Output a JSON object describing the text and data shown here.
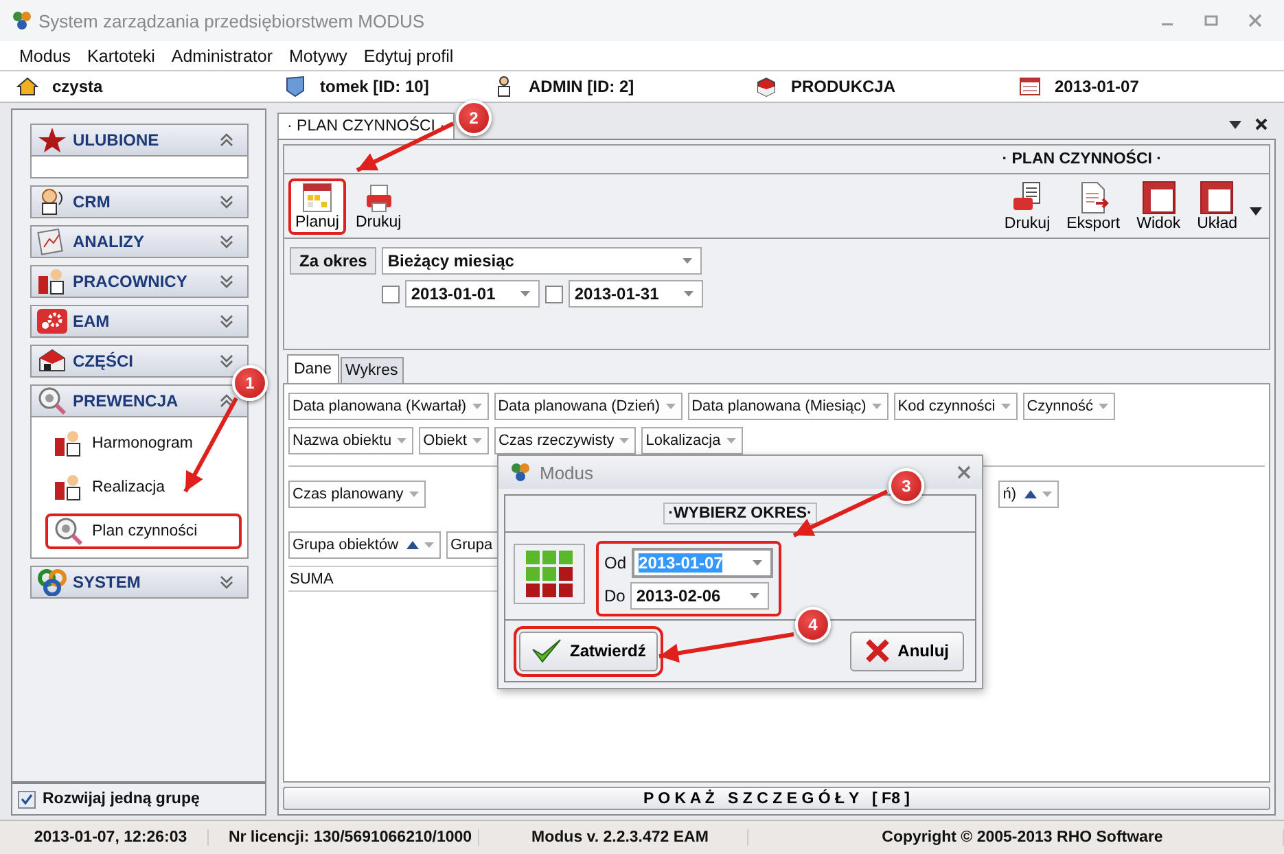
{
  "window": {
    "title": "System zarządzania przedsiębiorstwem MODUS"
  },
  "menu": [
    "Modus",
    "Kartoteki",
    "Administrator",
    "Motywy",
    "Edytuj profil"
  ],
  "info_bar": [
    {
      "kind": "home",
      "text": "czysta"
    },
    {
      "kind": "user",
      "text": "tomek [ID: 10]"
    },
    {
      "kind": "person",
      "text": "ADMIN [ID: 2]"
    },
    {
      "kind": "box",
      "text": "PRODUKCJA"
    },
    {
      "kind": "calendar",
      "text": "2013-01-07"
    }
  ],
  "sidebar": {
    "groups": [
      {
        "kind": "star",
        "label": "ULUBIONE",
        "expanded": true
      },
      {
        "kind": "person",
        "label": "CRM",
        "expanded": false
      },
      {
        "kind": "chart",
        "label": "ANALIZY",
        "expanded": false
      },
      {
        "kind": "tools",
        "label": "PRACOWNICY",
        "expanded": false
      },
      {
        "kind": "gear",
        "label": "EAM",
        "expanded": false
      },
      {
        "kind": "box",
        "label": "CZĘŚCI",
        "expanded": false
      },
      {
        "kind": "magnifier",
        "label": "PREWENCJA",
        "expanded": true,
        "children": [
          {
            "kind": "tools",
            "label": "Harmonogram",
            "highlighted": false
          },
          {
            "kind": "tools",
            "label": "Realizacja",
            "highlighted": false
          },
          {
            "kind": "magnifier",
            "label": "Plan czynności",
            "highlighted": true
          }
        ]
      },
      {
        "kind": "rings",
        "label": "SYSTEM",
        "expanded": false
      }
    ],
    "expand_one_group": {
      "label": "Rozwijaj jedną grupę",
      "checked": true
    }
  },
  "document_tab": {
    "label": "· PLAN CZYNNOŚCI ·"
  },
  "panel_title": "· PLAN CZYNNOŚCI ·",
  "toolbar_left": [
    {
      "kind": "plan",
      "label": "Planuj",
      "highlighted": true
    },
    {
      "kind": "printer",
      "label": "Drukuj",
      "highlighted": false
    }
  ],
  "toolbar_right": [
    {
      "kind": "print-doc",
      "label": "Drukuj"
    },
    {
      "kind": "export",
      "label": "Eksport"
    },
    {
      "kind": "grid",
      "label": "Widok"
    },
    {
      "kind": "grid",
      "label": "Układ"
    }
  ],
  "period": {
    "label": "Za okres",
    "preset": "Bieżący miesiąc",
    "from": {
      "checked": false,
      "value": "2013-01-01"
    },
    "to": {
      "checked": false,
      "value": "2013-01-31"
    }
  },
  "view_tabs": [
    {
      "label": "Dane",
      "selected": true
    },
    {
      "label": "Wykres",
      "selected": false
    }
  ],
  "filter_fields": [
    [
      {
        "label": "Data planowana (Kwartał)",
        "sorted": false
      },
      {
        "label": "Data planowana (Dzień)",
        "sorted": false
      },
      {
        "label": "Data planowana (Miesiąc)",
        "sorted": false
      },
      {
        "label": "Kod czynności",
        "sorted": false
      },
      {
        "label": "Czynność",
        "sorted": false
      }
    ],
    [
      {
        "label": "Nazwa obiektu",
        "sorted": false
      },
      {
        "label": "Obiekt",
        "sorted": false
      },
      {
        "label": "Czas rzeczywisty",
        "sorted": false
      },
      {
        "label": "Lokalizacja",
        "sorted": false
      }
    ]
  ],
  "data_field": {
    "label": "Czas planowany",
    "sorted": false
  },
  "column_field": {
    "label": "ń)",
    "sorted": true
  },
  "row_fields": [
    {
      "label": "Grupa obiektów",
      "sorted": true
    },
    {
      "label": "Grupa",
      "sorted": false
    }
  ],
  "grid_row": "SUMA",
  "details_button": "P O K A Ż   S Z C Z E G Ó Ł Y   [ F8 ]",
  "dialog": {
    "title": "Modus",
    "heading": "·WYBIERZ OKRES·",
    "from_label": "Od",
    "from": "2013-01-07",
    "to_label": "Do",
    "to": "2013-02-06",
    "confirm": "Zatwierdź",
    "cancel": "Anuluj"
  },
  "status_bar": [
    "2013-01-07,  12:26:03",
    "Nr licencji: 130/5691066210/1000",
    "Modus v. 2.2.3.472 EAM",
    "Copyright © 2005-2013 RHO Software"
  ],
  "annotations": [
    "1",
    "2",
    "3",
    "4"
  ]
}
